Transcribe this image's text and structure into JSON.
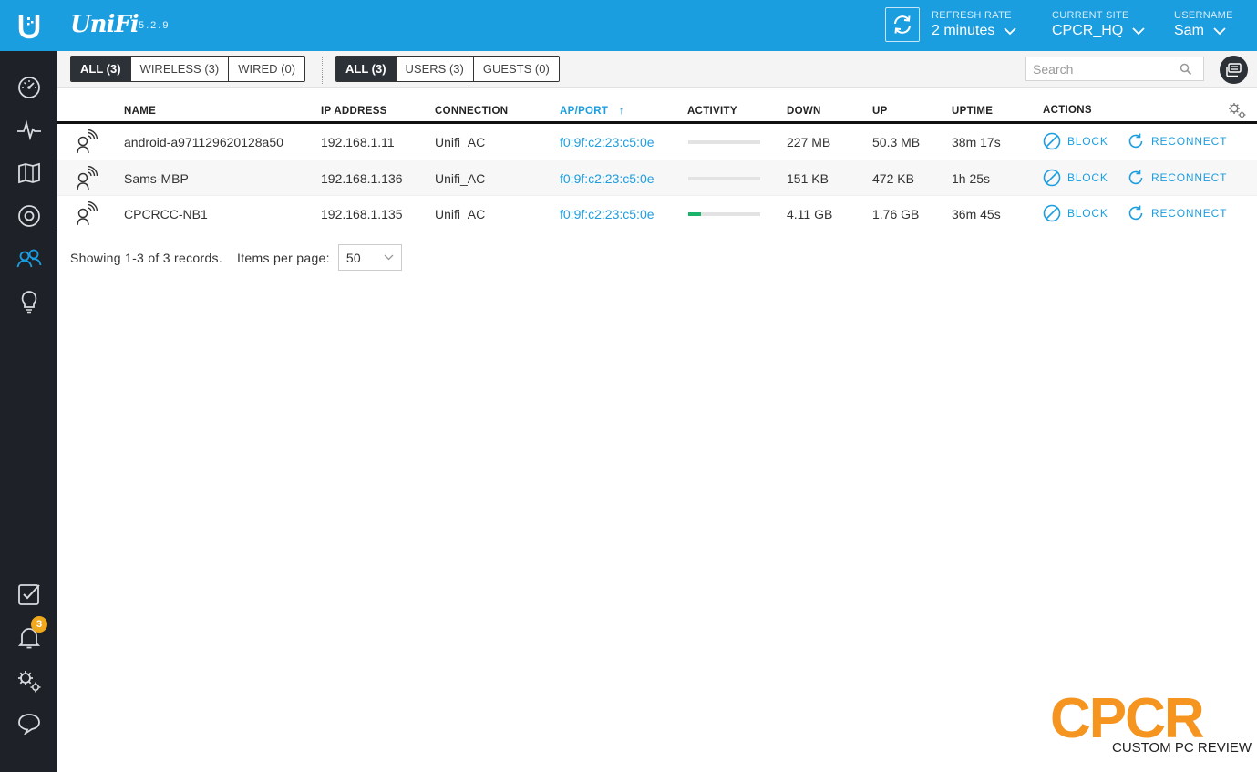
{
  "header": {
    "brand": "UniFi",
    "version": "5.2.9",
    "refresh_rate": {
      "label": "REFRESH RATE",
      "value": "2 minutes"
    },
    "current_site": {
      "label": "CURRENT SITE",
      "value": "CPCR_HQ"
    },
    "username": {
      "label": "USERNAME",
      "value": "Sam"
    },
    "accent_color": "#1b9ee0"
  },
  "sidebar": {
    "items": [
      {
        "name": "dashboard",
        "icon": "speedometer-icon"
      },
      {
        "name": "statistics",
        "icon": "pulse-icon"
      },
      {
        "name": "map",
        "icon": "map-icon"
      },
      {
        "name": "devices",
        "icon": "device-circle-icon"
      },
      {
        "name": "clients",
        "icon": "users-icon",
        "active": true
      },
      {
        "name": "insights",
        "icon": "lightbulb-icon"
      }
    ],
    "bottom_items": [
      {
        "name": "events",
        "icon": "checkbox-icon"
      },
      {
        "name": "alerts",
        "icon": "bell-icon",
        "badge": "3"
      },
      {
        "name": "settings",
        "icon": "gears-icon"
      },
      {
        "name": "chat",
        "icon": "chat-bubble-icon"
      }
    ],
    "badge_color": "#f0a81c"
  },
  "filters": {
    "connection_type": [
      {
        "label": "ALL (3)",
        "active": true
      },
      {
        "label": "WIRELESS (3)",
        "active": false
      },
      {
        "label": "WIRED (0)",
        "active": false
      }
    ],
    "user_type": [
      {
        "label": "ALL (3)",
        "active": true
      },
      {
        "label": "USERS (3)",
        "active": false
      },
      {
        "label": "GUESTS (0)",
        "active": false
      }
    ],
    "search_placeholder": "Search"
  },
  "table": {
    "columns": [
      "NAME",
      "IP ADDRESS",
      "CONNECTION",
      "AP/PORT",
      "ACTIVITY",
      "DOWN",
      "UP",
      "UPTIME",
      "ACTIONS"
    ],
    "sorted_column": "AP/PORT",
    "sort_arrow": "↑",
    "rows": [
      {
        "name": "android-a971129620128a50",
        "ip": "192.168.1.11",
        "connection": "Unifi_AC",
        "ap_port": "f0:9f:c2:23:c5:0e",
        "activity": 0.0,
        "down": "227 MB",
        "up": "50.3 MB",
        "uptime": "38m 17s"
      },
      {
        "name": "Sams-MBP",
        "ip": "192.168.1.136",
        "connection": "Unifi_AC",
        "ap_port": "f0:9f:c2:23:c5:0e",
        "activity": 0.0,
        "down": "151 KB",
        "up": "472 KB",
        "uptime": "1h 25s"
      },
      {
        "name": "CPCRCC-NB1",
        "ip": "192.168.1.135",
        "connection": "Unifi_AC",
        "ap_port": "f0:9f:c2:23:c5:0e",
        "activity": 0.18,
        "down": "4.11 GB",
        "up": "1.76 GB",
        "uptime": "36m 45s"
      }
    ],
    "actions": {
      "block": "BLOCK",
      "reconnect": "RECONNECT"
    },
    "activity_color": "#19b369"
  },
  "pagination": {
    "summary": "Showing 1-3 of 3 records.",
    "per_page_label": "Items per page:",
    "per_page_value": "50"
  },
  "watermark": {
    "logo": "CPCR",
    "tagline": "CUSTOM PC REVIEW",
    "color": "#f5951f"
  }
}
